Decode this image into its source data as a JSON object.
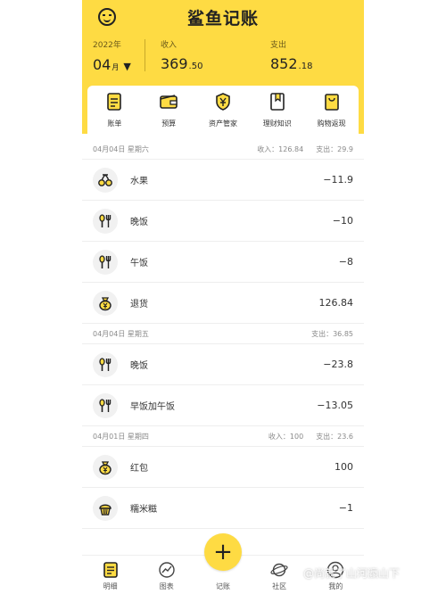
{
  "header": {
    "title": "鲨鱼记账",
    "year_label": "2022年",
    "month_num": "04",
    "month_unit": "月",
    "month_caret": "▼",
    "income_label": "收入",
    "expense_label": "支出",
    "income_int": "369",
    "income_dec": ".50",
    "expense_int": "852",
    "expense_dec": ".18",
    "accent_color": "#FEDB43"
  },
  "shortcuts": [
    {
      "label": "账单",
      "icon": "bill-icon"
    },
    {
      "label": "预算",
      "icon": "wallet-icon"
    },
    {
      "label": "资产管家",
      "icon": "shield-yen-icon"
    },
    {
      "label": "理财知识",
      "icon": "bookmark-book-icon"
    },
    {
      "label": "购物返现",
      "icon": "shopping-bag-icon"
    }
  ],
  "days": [
    {
      "date": "04月04日 星期六",
      "income": "收入：126.84",
      "expense": "支出：29.9",
      "items": [
        {
          "name": "水果",
          "amount": "−11.9",
          "icon": "cherry-icon"
        },
        {
          "name": "晚饭",
          "amount": "−10",
          "icon": "fork-spoon-icon"
        },
        {
          "name": "午饭",
          "amount": "−8",
          "icon": "fork-spoon-icon"
        },
        {
          "name": "退货",
          "amount": "126.84",
          "icon": "money-bag-icon"
        }
      ]
    },
    {
      "date": "04月04日 星期五",
      "income": "",
      "expense": "支出：36.85",
      "items": [
        {
          "name": "晚饭",
          "amount": "−23.8",
          "icon": "fork-spoon-icon"
        },
        {
          "name": "早饭加午饭",
          "amount": "−13.05",
          "icon": "fork-spoon-icon"
        }
      ]
    },
    {
      "date": "04月01日 星期四",
      "income": "收入：100",
      "expense": "支出：23.6",
      "items": [
        {
          "name": "红包",
          "amount": "100",
          "icon": "red-packet-icon"
        },
        {
          "name": "糯米糍",
          "amount": "−1",
          "icon": "cupcake-icon"
        }
      ]
    }
  ],
  "nav": {
    "details": "明细",
    "charts": "图表",
    "record": "记账",
    "record_symbol": "+",
    "community": "社区",
    "me": "我的"
  },
  "watermark": "@尚就了山河瀛山下"
}
